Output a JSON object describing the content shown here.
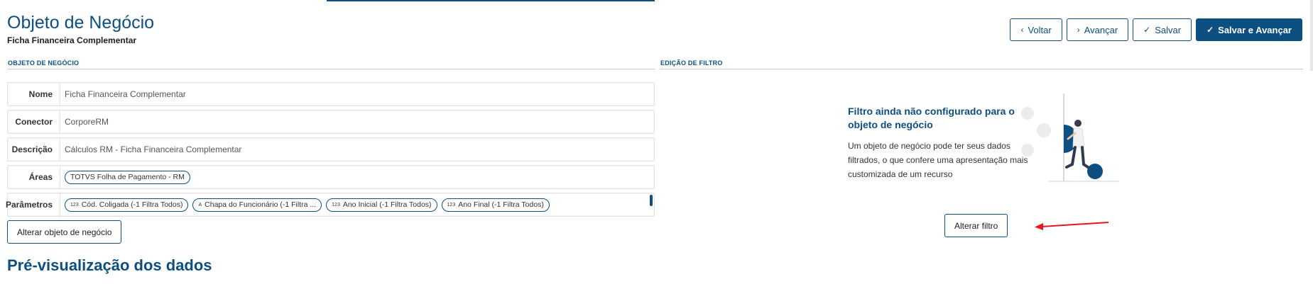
{
  "header": {
    "title": "Objeto de Negócio",
    "subtitle": "Ficha Financeira Complementar"
  },
  "actions": {
    "back": "Voltar",
    "next": "Avançar",
    "save": "Salvar",
    "save_next": "Salvar e Avançar"
  },
  "sections": {
    "business_object": "OBJETO DE NEGÓCIO",
    "filter_edit": "EDIÇÃO DE FILTRO"
  },
  "form": {
    "name_label": "Nome",
    "name_value": "Ficha Financeira Complementar",
    "connector_label": "Conector",
    "connector_value": "CorporeRM",
    "description_label": "Descrição",
    "description_value": "Cálculos RM - Ficha Financeira Complementar",
    "areas_label": "Áreas",
    "areas": [
      "TOTVS Folha de Pagamento - RM"
    ],
    "params_label": "Parâmetros",
    "params": [
      {
        "type": "123",
        "label": "Cód. Coligada (-1 Filtra Todos)"
      },
      {
        "type": "A",
        "label": "Chapa do Funcionário (-1 Filtra ..."
      },
      {
        "type": "123",
        "label": "Ano Inicial (-1 Filtra Todos)"
      },
      {
        "type": "123",
        "label": "Ano Final (-1 Filtra Todos)"
      }
    ]
  },
  "alter_object_button": "Alterar objeto de negócio",
  "filter": {
    "empty_title": "Filtro ainda não configurado para o objeto de negócio",
    "empty_desc": "Um objeto de negócio pode ter seus dados filtrados, o que confere uma apresentação mais customizada de um recurso",
    "alter_filter_button": "Alterar filtro"
  },
  "preview": {
    "title": "Pré-visualização dos dados"
  },
  "colors": {
    "primary": "#0c4f80",
    "annotation_arrow": "#e8151b"
  }
}
